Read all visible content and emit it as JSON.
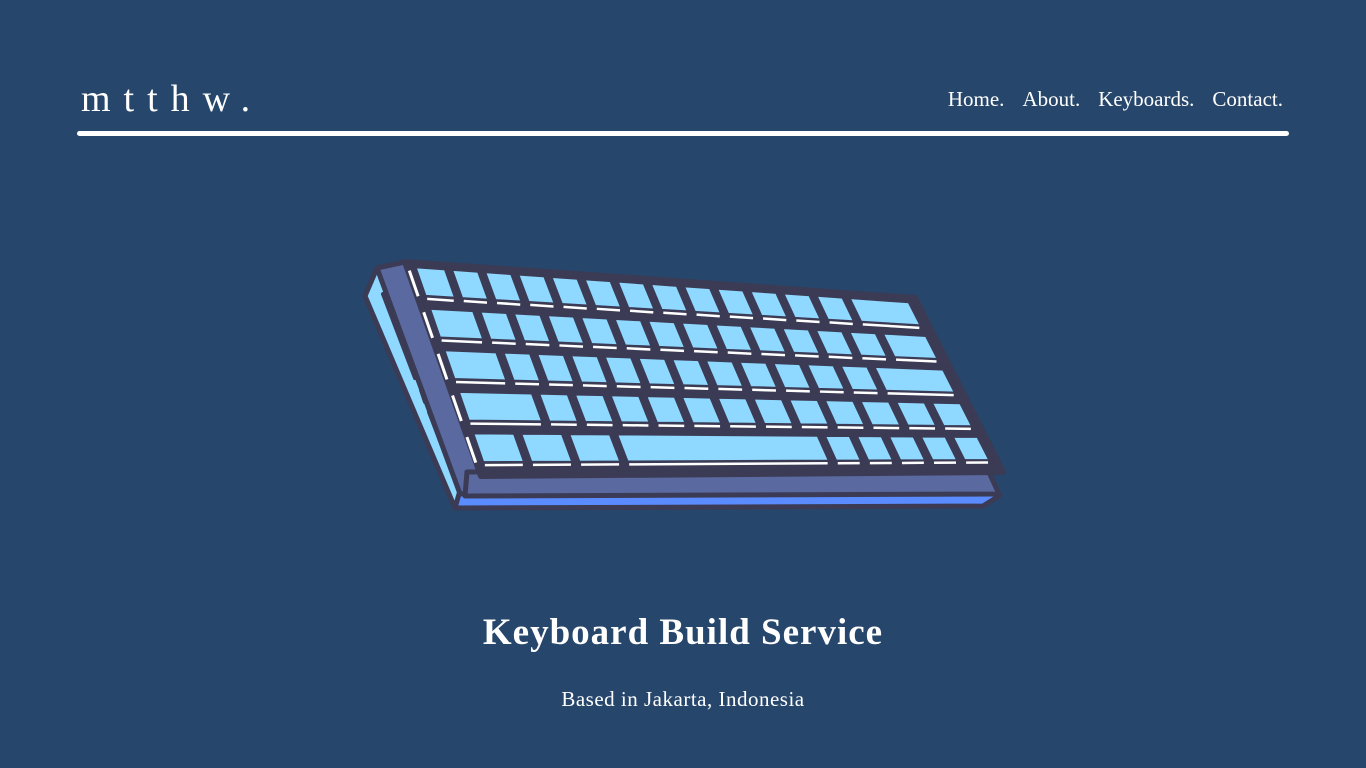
{
  "header": {
    "logo": "mtthw.",
    "nav": [
      {
        "label": "Home."
      },
      {
        "label": "About."
      },
      {
        "label": "Keyboards."
      },
      {
        "label": "Contact."
      }
    ]
  },
  "hero": {
    "illustration_icon": "keyboard-icon",
    "title": "Keyboard Build Service",
    "subtitle": "Based in Jakarta, Indonesia"
  },
  "colors": {
    "background": "#26466b",
    "text": "#ffffff",
    "keycap": "#8fd8ff",
    "keyboard_outline": "#3b3b55",
    "case_side": "#5a6aa0",
    "case_base": "#5b8cff"
  }
}
